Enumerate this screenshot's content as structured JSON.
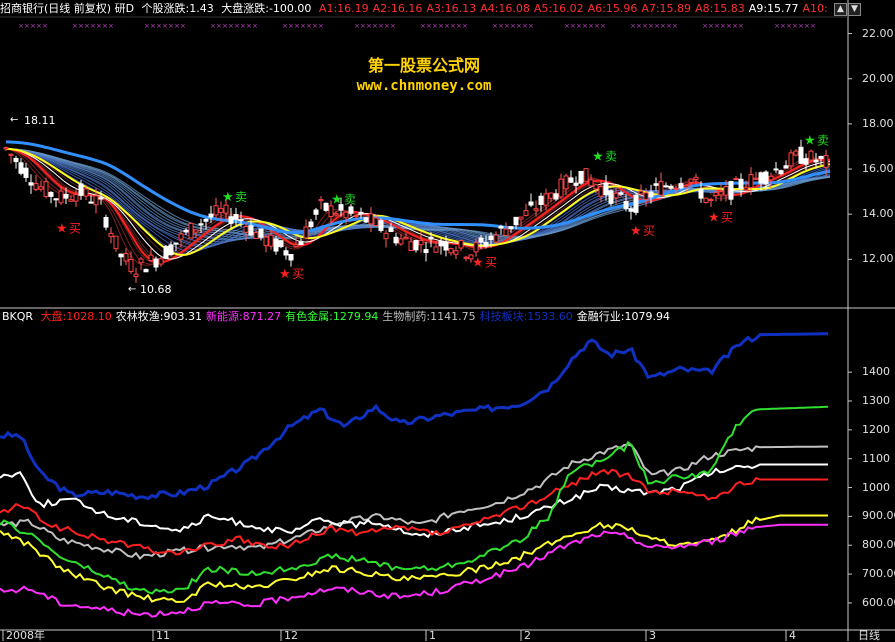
{
  "header": {
    "title": "招商银行(日线 前复权) 研D",
    "stock_change": "个股涨跌:1.43",
    "market_change": "大盘涨跌:-100.00",
    "levels": [
      "A1:16.19",
      "A2:16.16",
      "A3:16.13",
      "A4:16.08",
      "A5:16.02",
      "A6:15.96",
      "A7:15.89",
      "A8:15.83",
      "A9:15.77",
      "A10:"
    ],
    "title_color": "#ffffff",
    "level_color": "#ff3030"
  },
  "controls": {
    "up": "▲",
    "down": "▼"
  },
  "watermark": {
    "line1": "第一股票公式网",
    "line2": "www.chnmoney.com"
  },
  "price_axis": {
    "ticks": [
      "22.00",
      "20.00",
      "18.00",
      "16.00",
      "14.00",
      "12.00"
    ],
    "ymin": 10.2,
    "ymax": 22.6
  },
  "annotations": {
    "high": "18.11",
    "low": "10.68",
    "buy": "买",
    "sell": "卖"
  },
  "indicator": {
    "name": "BKQR",
    "items": [
      {
        "label": "大盘:1028.10",
        "color": "#ff2020"
      },
      {
        "label": "农林牧渔:903.31",
        "color": "#ffffff"
      },
      {
        "label": "新能源:871.27",
        "color": "#ff30ff"
      },
      {
        "label": "有色金属:1279.94",
        "color": "#30ff30"
      },
      {
        "label": "生物制药:1141.75",
        "color": "#c0c0c0"
      },
      {
        "label": "科技板块:1533.60",
        "color": "#1030c0"
      },
      {
        "label": "金融行业:1079.94",
        "color": "#ffffff"
      }
    ],
    "axis_ticks": [
      "1400",
      "1300",
      "1200",
      "1100",
      "1000",
      "900.00",
      "800.00",
      "700.00",
      "600.00"
    ],
    "ymin": 520,
    "ymax": 1560
  },
  "time_axis": {
    "labels": [
      "2008年",
      "11",
      "12",
      "1",
      "2",
      "3",
      "4"
    ],
    "right_label": "日线"
  }
}
